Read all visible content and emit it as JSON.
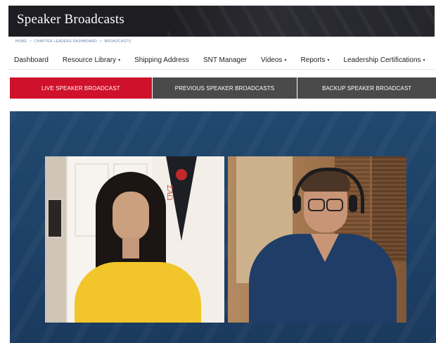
{
  "header": {
    "title": "Speaker Broadcasts"
  },
  "breadcrumb": {
    "items": [
      "HOME",
      "CHAPTER LEADERS DASHBOARD",
      "BROADCASTS"
    ],
    "separator": ">"
  },
  "nav": {
    "items": [
      {
        "label": "Dashboard",
        "has_dropdown": false
      },
      {
        "label": "Resource Library",
        "has_dropdown": true
      },
      {
        "label": "Shipping Address",
        "has_dropdown": false
      },
      {
        "label": "SNT Manager",
        "has_dropdown": false
      },
      {
        "label": "Videos",
        "has_dropdown": true
      },
      {
        "label": "Reports",
        "has_dropdown": true
      },
      {
        "label": "Leadership Certifications",
        "has_dropdown": true
      }
    ],
    "dropdown_glyph": "▾"
  },
  "tabs": [
    {
      "label": "LIVE SPEAKER BROADCAST",
      "active": true
    },
    {
      "label": "PREVIOUS SPEAKER BROADCASTS",
      "active": false
    },
    {
      "label": "BACKUP SPEAKER BROADCAST",
      "active": false
    }
  ],
  "video": {
    "pennant_text": "ΣΑΩ"
  },
  "colors": {
    "header_bg": "#1e1e22",
    "active_tab": "#d0112b",
    "inactive_tab": "#4a4a4a",
    "video_bg": "#21486e",
    "breadcrumb": "#5a7fa6"
  }
}
